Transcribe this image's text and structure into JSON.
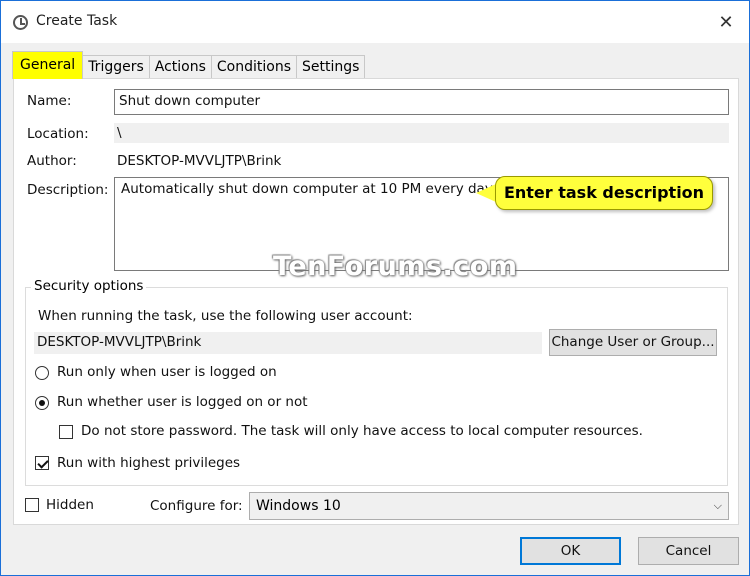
{
  "window": {
    "title": "Create Task",
    "close_glyph": "✕"
  },
  "tabs": [
    {
      "label": "General",
      "active": true
    },
    {
      "label": "Triggers",
      "active": false
    },
    {
      "label": "Actions",
      "active": false
    },
    {
      "label": "Conditions",
      "active": false
    },
    {
      "label": "Settings",
      "active": false
    }
  ],
  "general": {
    "name_label": "Name:",
    "name_value": "Shut down computer",
    "location_label": "Location:",
    "location_value": "\\",
    "author_label": "Author:",
    "author_value": "DESKTOP-MVVLJTP\\Brink",
    "description_label": "Description:",
    "description_value": "Automatically shut down computer at 10 PM every day."
  },
  "callout": {
    "text": "Enter task description",
    "color": "#ffff3c"
  },
  "watermark": "TenForums.com",
  "security": {
    "title": "Security options",
    "account_prompt": "When running the task, use the following user account:",
    "account_value": "DESKTOP-MVVLJTP\\Brink",
    "change_button": "Change User or Group...",
    "radio_logged_on": "Run only when user is logged on",
    "radio_logged_on_checked": false,
    "radio_whether": "Run whether user is logged on or not",
    "radio_whether_checked": true,
    "no_store_password": "Do not store password.  The task will only have access to local computer resources.",
    "no_store_password_checked": false,
    "highest_privileges": "Run with highest privileges",
    "highest_privileges_checked": true
  },
  "footer": {
    "hidden_label": "Hidden",
    "hidden_checked": false,
    "configure_label": "Configure for:",
    "configure_value": "Windows 10"
  },
  "buttons": {
    "ok": "OK",
    "cancel": "Cancel"
  },
  "colors": {
    "active_tab_highlight": "#ffff00",
    "window_border": "#1a6fd8",
    "default_button_border": "#0078d7"
  }
}
